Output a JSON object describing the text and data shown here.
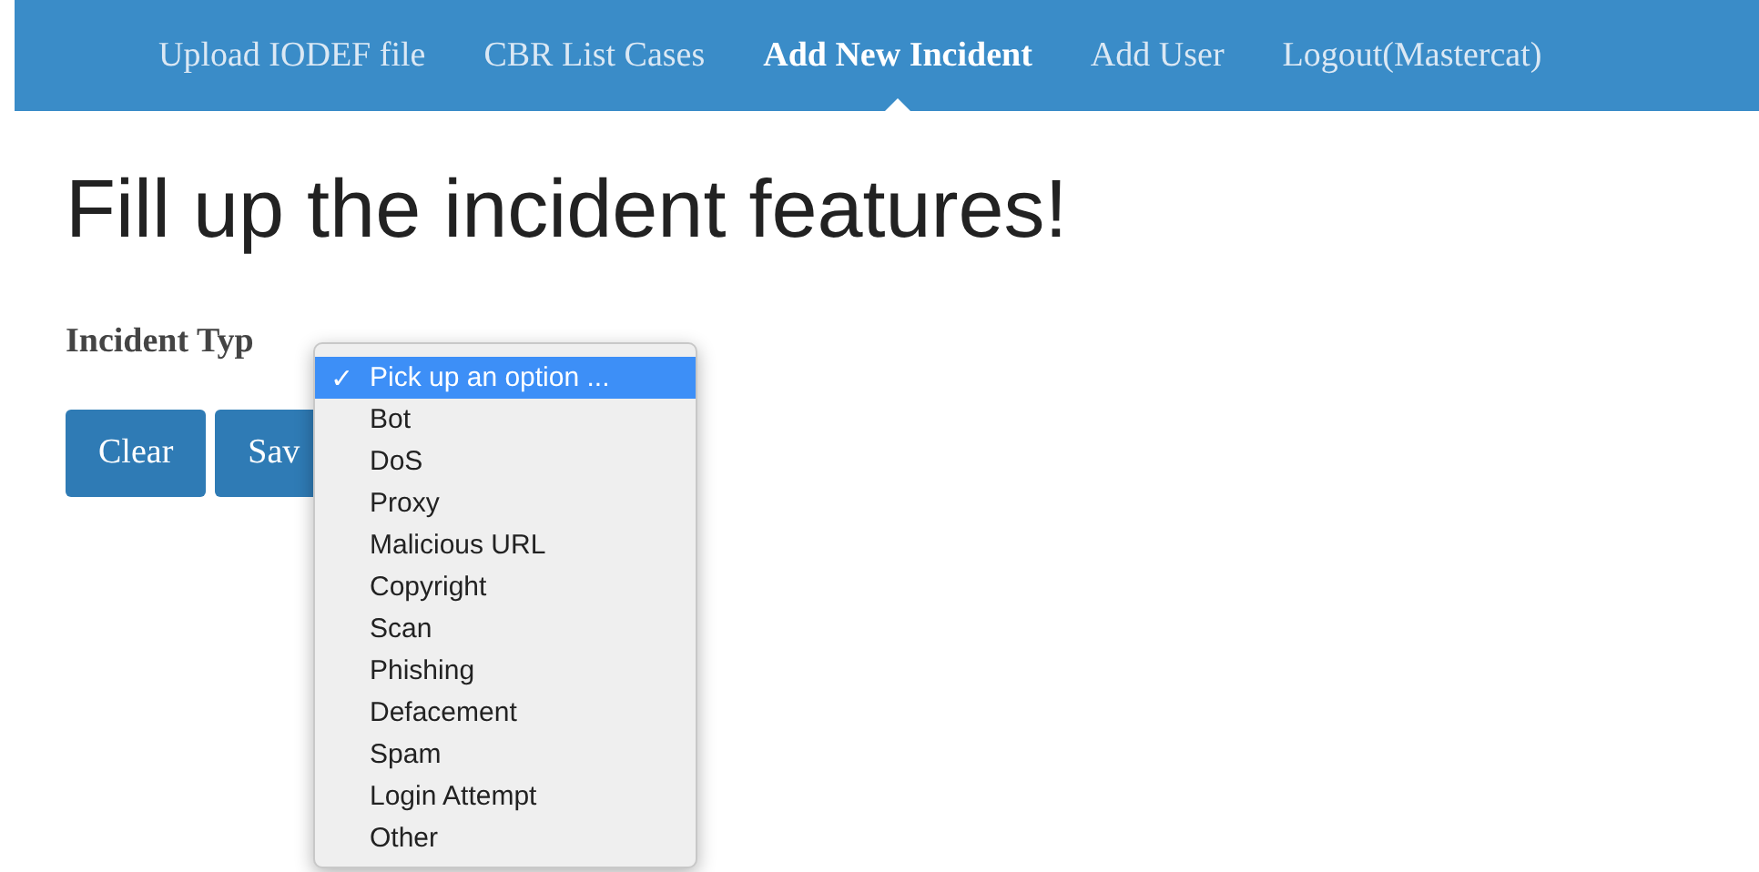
{
  "nav": [
    {
      "label": "Upload IODEF file",
      "selected": false
    },
    {
      "label": "CBR List Cases",
      "selected": false
    },
    {
      "label": "Add New Incident",
      "selected": true
    },
    {
      "label": "Add User",
      "selected": false
    },
    {
      "label": "Logout(Mastercat)",
      "selected": false
    }
  ],
  "heading": "Fill up the incident features!",
  "field_label": "Incident Typ",
  "buttons": [
    "Clear",
    "Sav"
  ],
  "dropdown": {
    "check": "✓",
    "options": [
      {
        "label": "Pick up an option ...",
        "selected": true
      },
      {
        "label": "Bot",
        "selected": false
      },
      {
        "label": "DoS",
        "selected": false
      },
      {
        "label": "Proxy",
        "selected": false
      },
      {
        "label": "Malicious URL",
        "selected": false
      },
      {
        "label": "Copyright",
        "selected": false
      },
      {
        "label": "Scan",
        "selected": false
      },
      {
        "label": "Phishing",
        "selected": false
      },
      {
        "label": "Defacement",
        "selected": false
      },
      {
        "label": "Spam",
        "selected": false
      },
      {
        "label": "Login Attempt",
        "selected": false
      },
      {
        "label": "Other",
        "selected": false
      }
    ]
  }
}
